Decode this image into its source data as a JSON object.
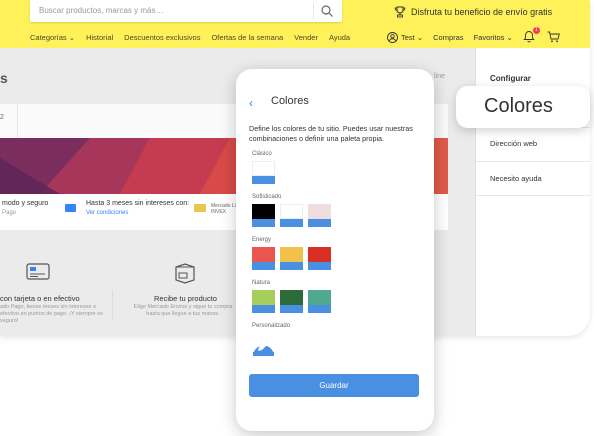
{
  "header": {
    "search_placeholder": "Buscar productos, marcas y más…",
    "promo": "Disfruta tu beneficio de envío gratis",
    "nav_left": [
      "Categorías ⌄",
      "Historial",
      "Descuentos exclusivos",
      "Ofertas de la semana",
      "Vender",
      "Ayuda"
    ],
    "user": "Test ⌄",
    "compras": "Compras",
    "favoritos": "Favoritos ⌄",
    "notifications_count": "1"
  },
  "page": {
    "title_fragment": "s",
    "tab_fragment": "2",
    "online_fragment": "line",
    "payments": {
      "item1": "modo y seguro",
      "item1_sub": "Pago",
      "item2": "Hasta 3 meses sin intereses con:",
      "item2_sub": "Ver condiciones",
      "item3_line1": "Mercado Lib",
      "item3_line2": "INVEX"
    },
    "benefits": {
      "b1_title": "con tarjeta o en efectivo",
      "b1_text": "ado Pago, tienes meses sin intereses o efectivo en puntos de pago. ¡Y siempre es seguro!",
      "b2_title": "Recibe tu producto",
      "b2_text": "Elige Mercado Envíos y sigue tu compra hasta que llegue a tus manos."
    }
  },
  "sidebar": {
    "configurar": "Configurar",
    "direccion": "Dirección web",
    "ayuda": "Necesito ayuda"
  },
  "pill": {
    "label": "Colores"
  },
  "modal": {
    "back": "‹",
    "title": "Colores",
    "description": "Define los colores de tu sitio. Puedes usar nuestras combinaciones o definir una paleta propia.",
    "groups": [
      {
        "label": "Clásico",
        "swatches": [
          "#ffffff"
        ]
      },
      {
        "label": "Sofisticado",
        "swatches": [
          "#000000",
          "#ffffff",
          "#f0dde0"
        ]
      },
      {
        "label": "Energy",
        "swatches": [
          "#e8564f",
          "#f0c14b",
          "#d93025"
        ]
      },
      {
        "label": "Natura",
        "swatches": [
          "#a5cf5a",
          "#2e6b3c",
          "#4fa98f"
        ]
      }
    ],
    "custom_label": "Personalizado",
    "save": "Guardar"
  },
  "colors": {
    "brand_yellow": "#fff159",
    "primary_blue": "#4a90e2",
    "link_blue": "#3483fa"
  }
}
